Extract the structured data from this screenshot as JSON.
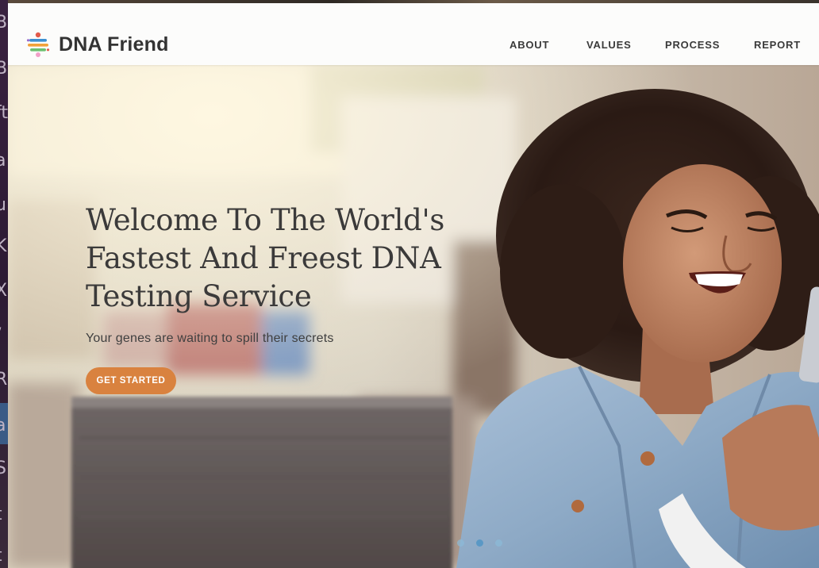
{
  "site": {
    "brand": "DNA Friend"
  },
  "nav": {
    "items": [
      {
        "label": "ABOUT"
      },
      {
        "label": "VALUES"
      },
      {
        "label": "PROCESS"
      },
      {
        "label": "REPORT"
      }
    ]
  },
  "hero": {
    "headline_lines": [
      "Welcome To The World's",
      "Fastest And Freest DNA",
      "Testing Service"
    ],
    "subtext": "Your genes are waiting to spill their secrets",
    "cta_label": "GET STARTED",
    "slides": {
      "count": 3,
      "active": 1
    }
  },
  "background_window": {
    "visible_chars": [
      "B",
      "B",
      "ft",
      "a",
      "u",
      "K",
      "X",
      "/",
      "R",
      "a",
      "Sl",
      "t",
      "t"
    ]
  },
  "colors": {
    "cta": "#d9823f",
    "nav_text": "#3a3a3a",
    "headline": "#3b3a3a",
    "dot_active": "#5a98c5"
  },
  "icons": {
    "logo": "dna-dots-logo-icon"
  }
}
